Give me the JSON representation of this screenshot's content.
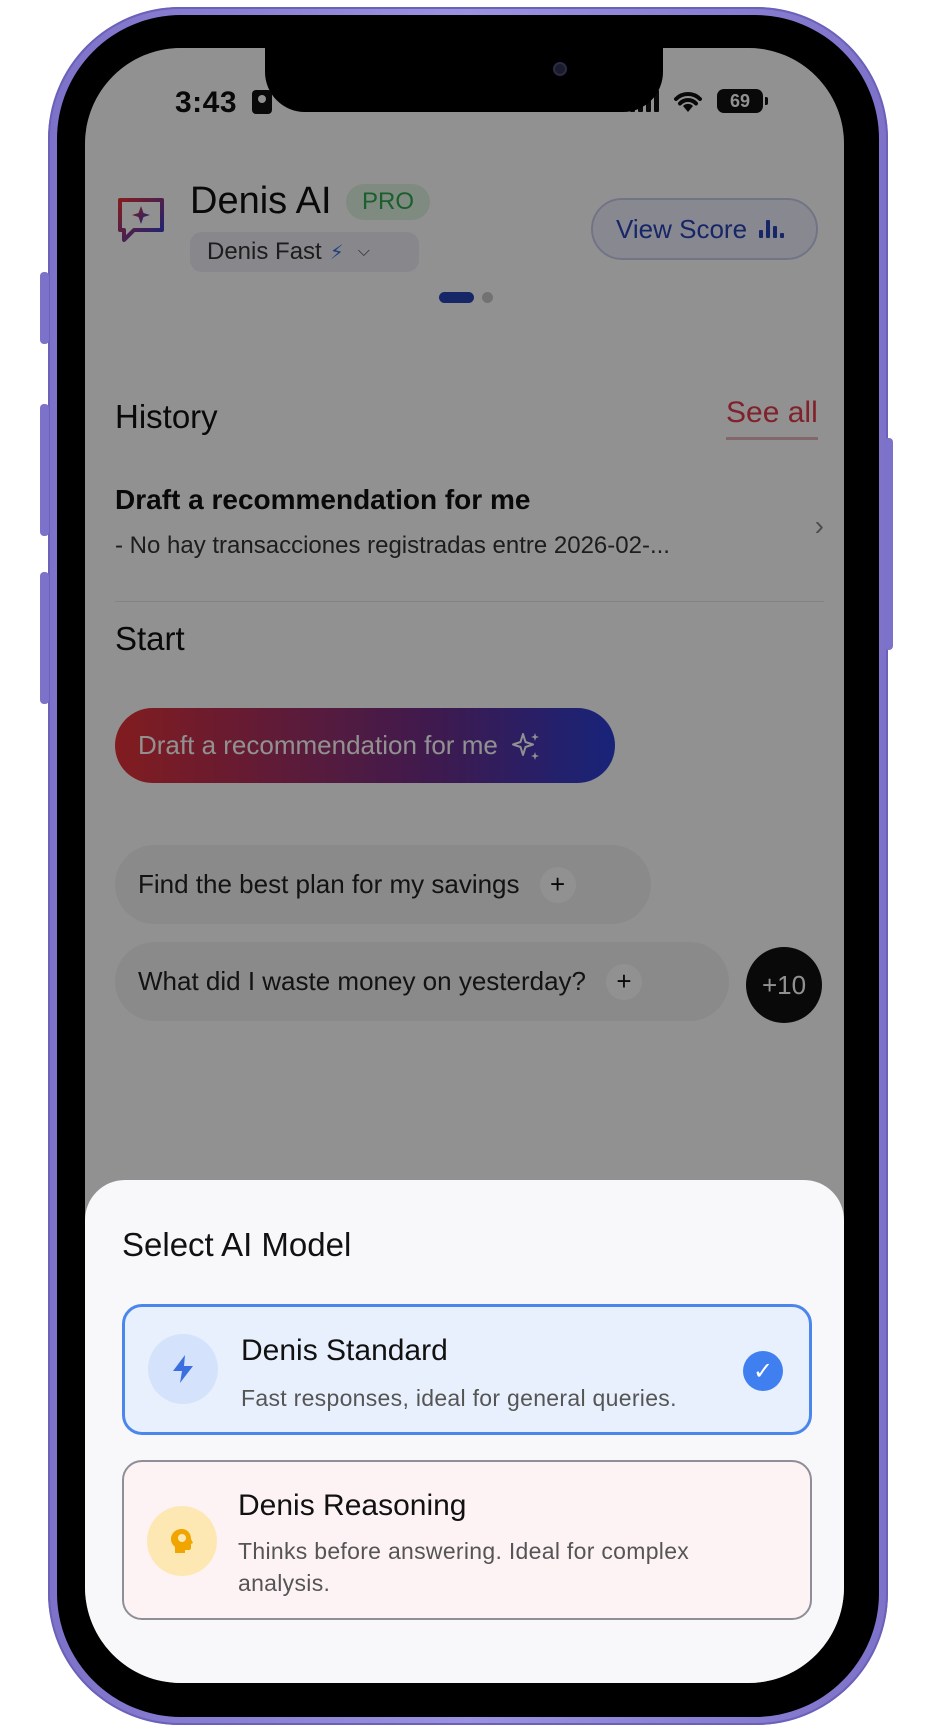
{
  "status_bar": {
    "time": "3:43",
    "battery": "69"
  },
  "header": {
    "app_title": "Denis AI",
    "plan_badge": "PRO",
    "model_selector_label": "Denis Fast",
    "view_score_label": "View Score"
  },
  "history": {
    "heading": "History",
    "see_all_label": "See all",
    "items": [
      {
        "title": "Draft a recommendation for me",
        "subtitle": "- No hay transacciones registradas entre 2026-02-..."
      }
    ]
  },
  "start": {
    "heading": "Start",
    "suggestions": [
      {
        "label": "Draft a recommendation for me"
      },
      {
        "label": "Find the best plan for my savings"
      },
      {
        "label": "What did I waste money on yesterday?"
      }
    ],
    "more_label": "+10"
  },
  "model_sheet": {
    "title": "Select AI Model",
    "options": [
      {
        "name": "Denis Standard",
        "description": "Fast responses, ideal for general queries.",
        "icon": "lightning-icon",
        "selected": true
      },
      {
        "name": "Denis Reasoning",
        "description": "Thinks before answering. Ideal for complex analysis.",
        "icon": "brain-icon",
        "selected": false
      }
    ]
  },
  "colors": {
    "accent_blue": "#2743b5",
    "accent_red": "#e23a4c",
    "pro_green": "#2fa84f",
    "selected_border": "#4b86ec",
    "phone_frame": "#7d72c9"
  }
}
